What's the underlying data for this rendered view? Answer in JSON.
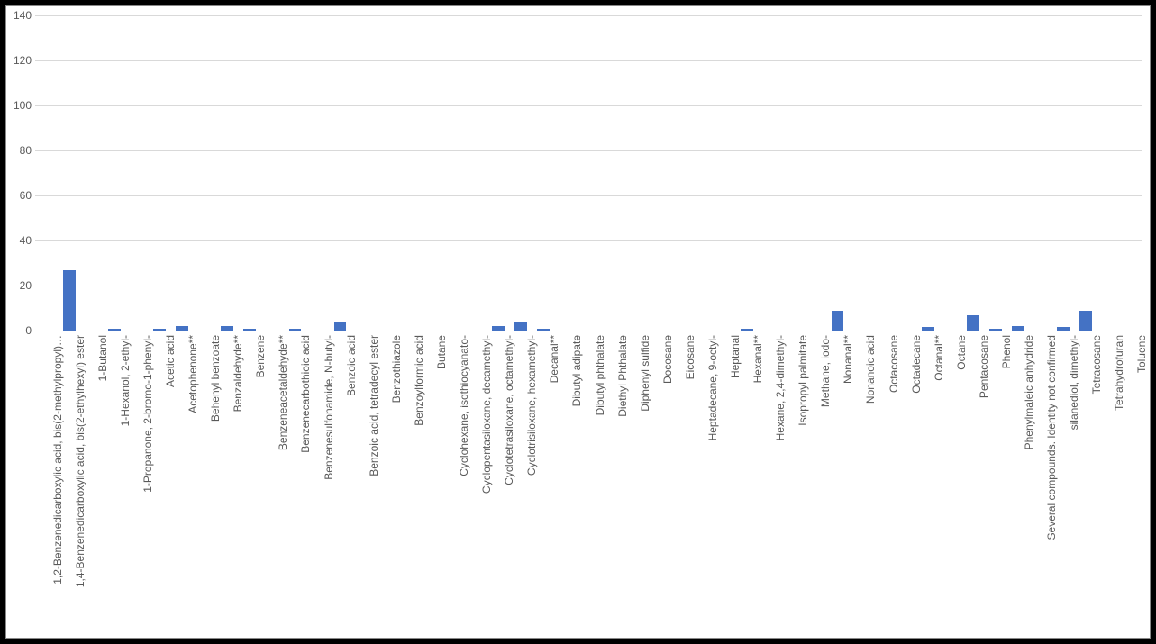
{
  "chart_data": {
    "type": "bar",
    "title": "",
    "xlabel": "",
    "ylabel": "",
    "ylim": [
      0,
      140
    ],
    "yticks": [
      0,
      20,
      40,
      60,
      80,
      100,
      120,
      140
    ],
    "bar_color": "#4472C4",
    "categories": [
      "1,2-Benzenedicarboxylic acid, bis(2-methylpropyl)…",
      "1,4-Benzenedicarboxylic acid, bis(2-ethylhexyl) ester",
      "1-Butanol",
      "1-Hexanol, 2-ethyl-",
      "1-Propanone, 2-bromo-1-phenyl-",
      "Acetic acid",
      "Acetophenone**",
      "Behenyl benzoate",
      "Benzaldehyde**",
      "Benzene",
      "Benzeneacetaldehyde**",
      "Benzenecarbothioic acid",
      "Benzenesulfonamide, N-butyl-",
      "Benzoic acid",
      "Benzoic acid, tetradecyl ester",
      "Benzothiazole",
      "Benzoylformic acid",
      "Butane",
      "Cyclohexane, isothiocyanato-",
      "Cyclopentasiloxane, decamethyl-",
      "Cyclotetrasiloxane, octamethyl-",
      "Cyclotrisiloxane, hexamethyl-",
      "Decanal**",
      "Dibutyl adipate",
      "Dibutyl phthalate",
      "Diethyl Phthalate",
      "Diphenyl sulfide",
      "Docosane",
      "Eicosane",
      "Heptadecane, 9-octyl-",
      "Heptanal",
      "Hexanal**",
      "Hexane, 2,4-dimethyl-",
      "Isopropyl palmitate",
      "Methane, iodo-",
      "Nonanal**",
      "Nonanoic acid",
      "Octacosane",
      "Octadecane",
      "Octanal**",
      "Octane",
      "Pentacosane",
      "Phenol",
      "Phenylmaleic anhydride",
      "Several compounds. Identity not confirmed",
      "silanediol, dimethyl-",
      "Tetracosane",
      "Tetrahydrofuran",
      "Toluene"
    ],
    "values": [
      0,
      27,
      0,
      1,
      0,
      1,
      2,
      0,
      2,
      1,
      0,
      1,
      0,
      3.5,
      0,
      0,
      0,
      0,
      0,
      0,
      2,
      4,
      1,
      0,
      0,
      0,
      0,
      0,
      0,
      0,
      0,
      1,
      0,
      0,
      0,
      9,
      0,
      0,
      0,
      1.5,
      0,
      7,
      1,
      2,
      0,
      1.5,
      9,
      0,
      0
    ]
  }
}
